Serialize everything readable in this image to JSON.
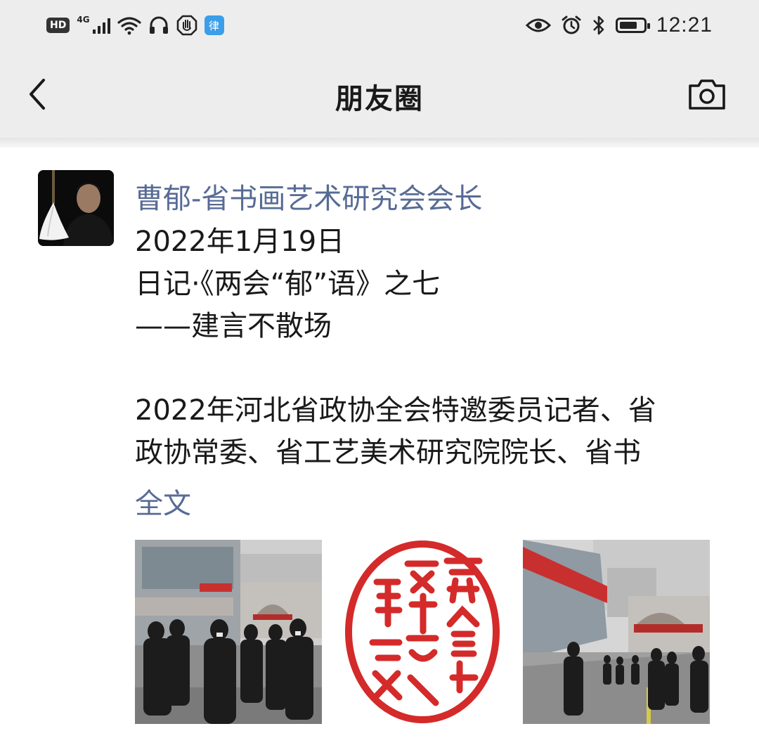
{
  "status_bar": {
    "hd_badge": "HD",
    "network": "4G",
    "time": "12:21",
    "battery_level": 0.75,
    "app_icon_glyph": "律",
    "icons_left": [
      "hd-icon",
      "signal-icon",
      "wifi-icon",
      "headphones-icon",
      "hand-stop-icon",
      "app-notification-icon"
    ],
    "icons_right": [
      "eye-icon",
      "alarm-icon",
      "bluetooth-icon",
      "battery-icon"
    ]
  },
  "nav": {
    "title": "朋友圈",
    "back_icon": "chevron-left-icon",
    "camera_icon": "camera-icon"
  },
  "post": {
    "author": "曹郁-省书画艺术研究会会长",
    "lines": [
      "2022年1月19日",
      "日记·《两会“郁”语》之七",
      "——建言不散场",
      "",
      "2022年河北省政协全会特邀委员记者、省",
      "政协常委、省工艺美术研究院院长、省书"
    ],
    "full_text_link": "全文",
    "photos": [
      "photo-crowd-outside-building",
      "photo-red-seal-stamp",
      "photo-conference-entrance"
    ]
  },
  "colors": {
    "bar_background": "#ededed",
    "link_blue": "#576b95",
    "text": "#191919",
    "seal_red": "#d42a2a",
    "app_blue": "#3b9ee8"
  }
}
